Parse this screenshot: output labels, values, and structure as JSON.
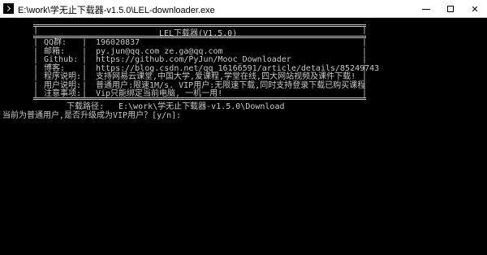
{
  "window": {
    "title": "E:\\work\\学无止下载器-v1.5.0\\LEL-downloader.exe",
    "min_icon": "minimize-icon",
    "max_icon": "maximize-icon",
    "close_icon": "close-icon",
    "close_glyph": "✕"
  },
  "banner": {
    "title": "LEL下载器(V1.5.0)",
    "rows": [
      {
        "label": "QQ群:",
        "value": "196020837"
      },
      {
        "label": "邮箱:",
        "value": "py.jun@qq.com   ze.ga@qq.com"
      },
      {
        "label": "Github:",
        "value": "https://github.com/PyJun/Mooc_Downloader"
      },
      {
        "label": "博客:",
        "value": "https://blog.csdn.net/qq_16166591/article/details/85249743"
      },
      {
        "label": "程序说明:",
        "value": "支持网易云课堂,中国大学,爱课程,学堂在线,四大网站视频及课件下载!"
      },
      {
        "label": "用户说明:",
        "value": "普通用户:限速1M/s.  VIP用户:无限速下载,同时支持登录下载已购买课程"
      },
      {
        "label": "注意事项:",
        "value": "Vip只能绑定当前电脑, 一机一用!"
      }
    ],
    "sep": "|"
  },
  "output": {
    "path_label": "下载路径:",
    "path_value": "E:\\work\\学无止下载器-v1.5.0\\Download",
    "prompt": "当前为普通用户,是否升级成为VIP用户？[y/n]:"
  }
}
